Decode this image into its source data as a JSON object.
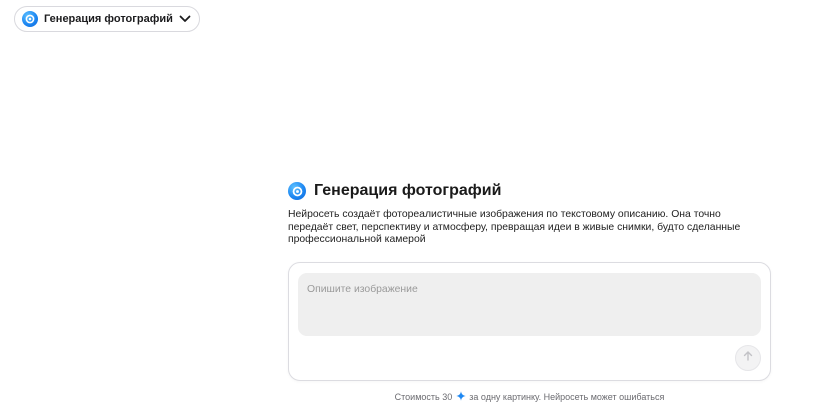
{
  "model_selector": {
    "label": "Генерация фотографий",
    "icon": "camera-logo-icon",
    "chevron_icon": "chevron-down-icon"
  },
  "intro": {
    "title": "Генерация фотографий",
    "description_lines": [
      "Нейросеть создаёт фотореалистичные изображения по текстовому описанию. Она точно",
      "передаёт свет, перспективу и атмосферу, превращая идеи в живые снимки, будто сделанные",
      "профессиональной камерой"
    ]
  },
  "prompt": {
    "value": "",
    "placeholder": "Опишите изображение",
    "send_icon": "arrow-up-icon"
  },
  "footer": {
    "before": "Стоимость 30",
    "icon": "sparkle-icon",
    "after": "за одну картинку. Нейросеть может ошибаться"
  },
  "colors": {
    "accent": "#1e88f2",
    "text": "#1a1a1a",
    "muted": "#6b6b70",
    "input_bg": "#efefef",
    "border": "#dcdce1"
  }
}
